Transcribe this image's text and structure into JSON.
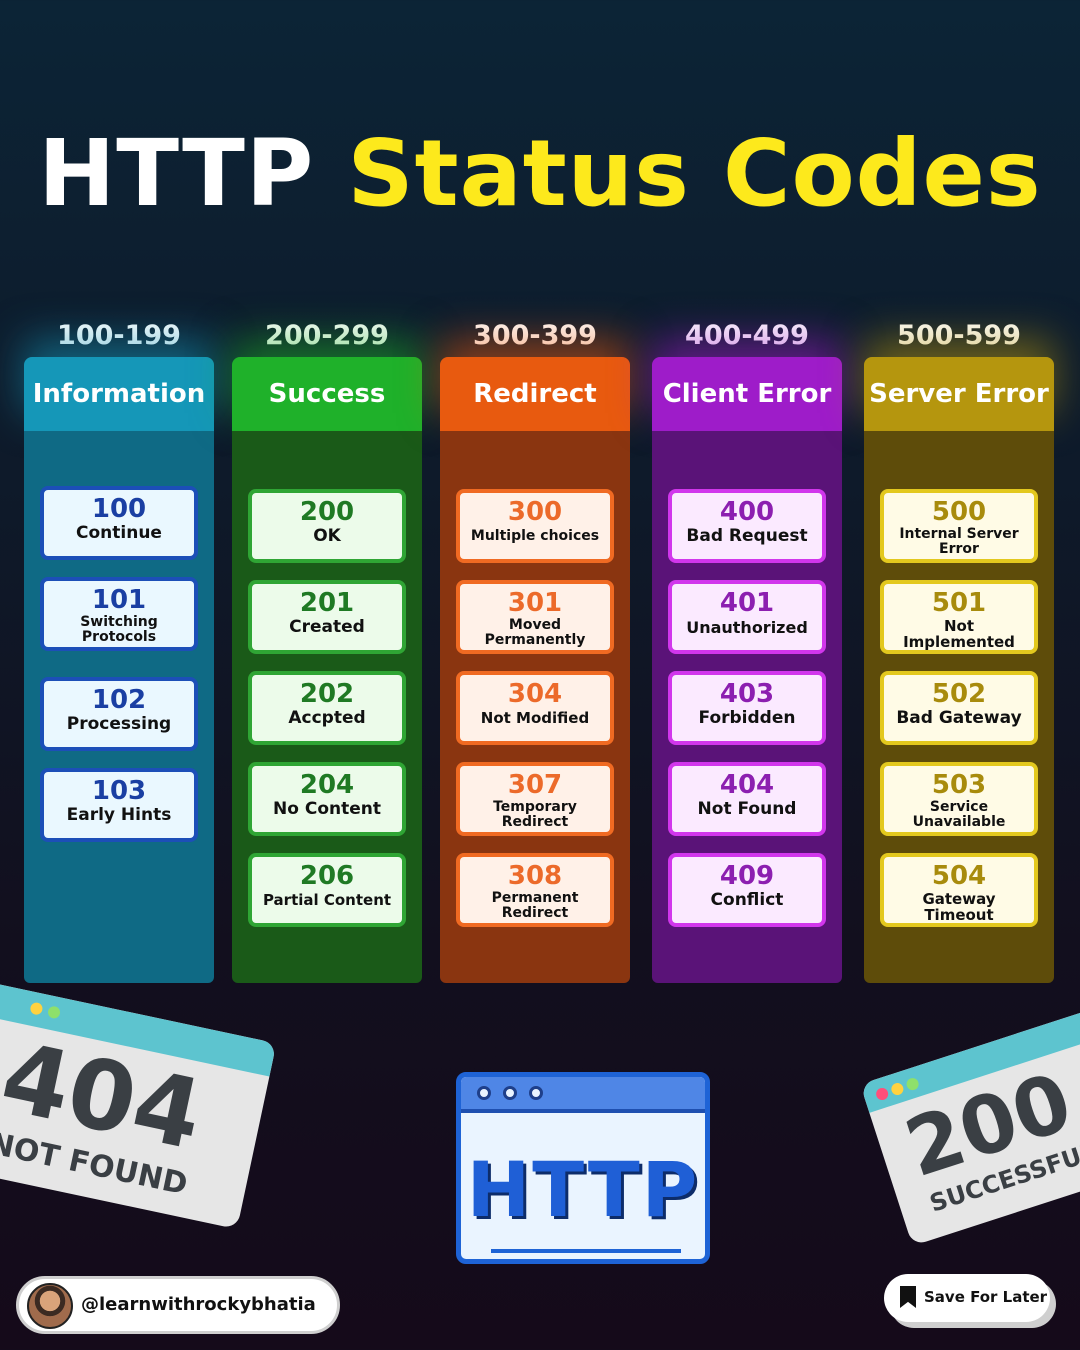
{
  "title": {
    "part1": "HTTP",
    "part2": "Status Codes"
  },
  "colors": {
    "title_white": "#ffffff",
    "title_yellow": "#fde91c",
    "information": "#1597b8",
    "success": "#1fb12a",
    "redirect": "#e85a0f",
    "client_error": "#9e1cc9",
    "server_error": "#b5960e"
  },
  "columns": [
    {
      "range": "100-199",
      "name": "Information",
      "cards": [
        {
          "code": "100",
          "label": "Continue"
        },
        {
          "code": "101",
          "label": "Switching Protocols"
        },
        {
          "code": "102",
          "label": "Processing"
        },
        {
          "code": "103",
          "label": "Early Hints"
        }
      ]
    },
    {
      "range": "200-299",
      "name": "Success",
      "cards": [
        {
          "code": "200",
          "label": "OK"
        },
        {
          "code": "201",
          "label": "Created"
        },
        {
          "code": "202",
          "label": "Accpted"
        },
        {
          "code": "204",
          "label": "No Content"
        },
        {
          "code": "206",
          "label": "Partial Content"
        }
      ]
    },
    {
      "range": "300-399",
      "name": "Redirect",
      "cards": [
        {
          "code": "300",
          "label": "Multiple choices"
        },
        {
          "code": "301",
          "label": "Moved Permanently"
        },
        {
          "code": "304",
          "label": "Not Modified"
        },
        {
          "code": "307",
          "label": "Temporary Redirect"
        },
        {
          "code": "308",
          "label": "Permanent Redirect"
        }
      ]
    },
    {
      "range": "400-499",
      "name": "Client Error",
      "cards": [
        {
          "code": "400",
          "label": "Bad Request"
        },
        {
          "code": "401",
          "label": "Unauthorized"
        },
        {
          "code": "403",
          "label": "Forbidden"
        },
        {
          "code": "404",
          "label": "Not Found"
        },
        {
          "code": "409",
          "label": "Conflict"
        }
      ]
    },
    {
      "range": "500-599",
      "name": "Server Error",
      "cards": [
        {
          "code": "500",
          "label": "Internal Server Error"
        },
        {
          "code": "501",
          "label": "Not Implemented"
        },
        {
          "code": "502",
          "label": "Bad Gateway"
        },
        {
          "code": "503",
          "label": "Service Unavailable"
        },
        {
          "code": "504",
          "label": "Gateway Timeout"
        }
      ]
    }
  ],
  "decor": {
    "left_window": {
      "number": "404",
      "caption": "NOT FOUND"
    },
    "center_window": {
      "word": "HTTP"
    },
    "right_window": {
      "number": "200",
      "caption": "SUCCESSFUL"
    }
  },
  "footer": {
    "handle": "@learnwithrockybhatia",
    "save_label": "Save For Later"
  }
}
